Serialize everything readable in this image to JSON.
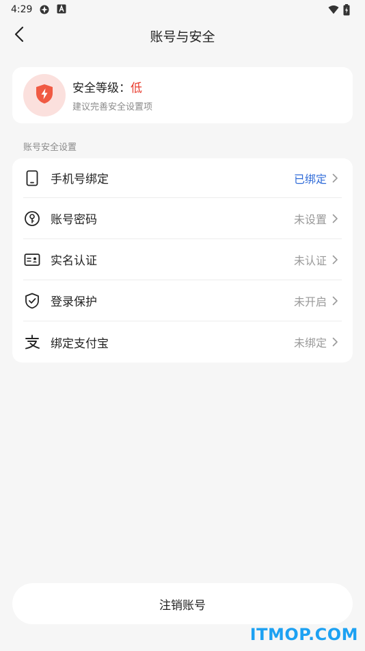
{
  "status_bar": {
    "time": "4:29",
    "icons": [
      "settings-icon",
      "a-badge-icon",
      "wifi-icon",
      "battery-icon"
    ]
  },
  "header": {
    "title": "账号与安全",
    "back_icon": "chevron-left-icon"
  },
  "security_level": {
    "icon": "shield-lightning-icon",
    "label": "安全等级：",
    "value": "低",
    "hint": "建议完善安全设置项",
    "value_color": "#e8392b",
    "badge_color": "#fbe0dd"
  },
  "section": {
    "label": "账号安全设置"
  },
  "settings": [
    {
      "icon": "phone-icon",
      "label": "手机号绑定",
      "status": "已绑定",
      "bound": true
    },
    {
      "icon": "key-icon",
      "label": "账号密码",
      "status": "未设置",
      "bound": false
    },
    {
      "icon": "id-card-icon",
      "label": "实名认证",
      "status": "未认证",
      "bound": false
    },
    {
      "icon": "shield-check-icon",
      "label": "登录保护",
      "status": "未开启",
      "bound": false
    },
    {
      "icon": "alipay-icon",
      "label": "绑定支付宝",
      "status": "未绑定",
      "bound": false
    }
  ],
  "logout": {
    "label": "注销账号"
  },
  "watermark": "ITMOP.COM",
  "colors": {
    "accent_blue": "#2f6bd8",
    "danger_red": "#e8392b",
    "background": "#f6f6f6"
  }
}
